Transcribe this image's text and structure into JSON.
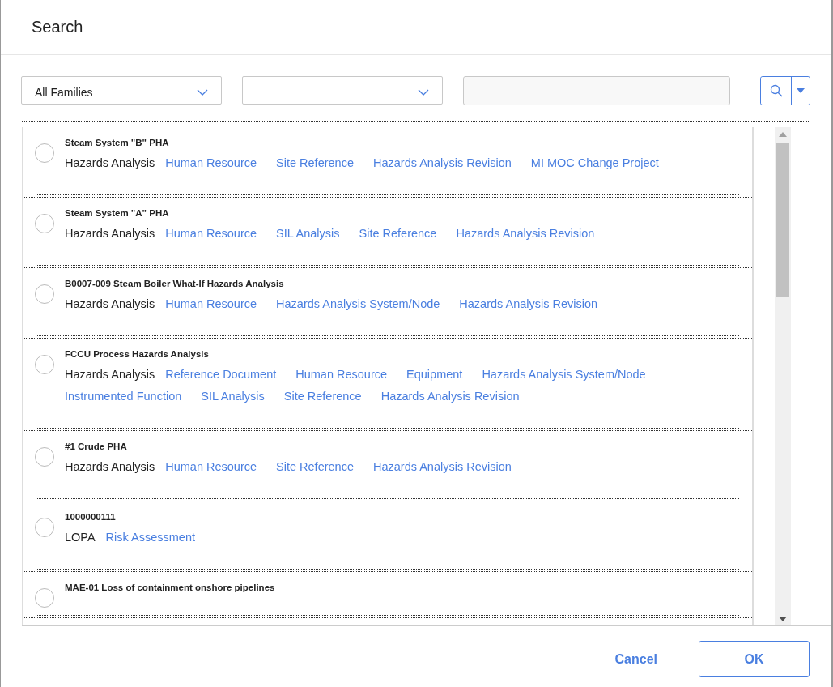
{
  "window": {
    "title": "Search"
  },
  "filters": {
    "family": {
      "value": "All Families"
    }
  },
  "results": [
    {
      "title": "Steam System \"B\" PHA",
      "selected": false,
      "family": "Hazards Analysis",
      "links": [
        "Human Resource",
        "Site Reference",
        "Hazards Analysis Revision",
        "MI MOC Change Project"
      ]
    },
    {
      "title": "Steam System \"A\" PHA",
      "selected": false,
      "family": "Hazards Analysis",
      "links": [
        "Human Resource",
        "SIL Analysis",
        "Site Reference",
        "Hazards Analysis Revision"
      ]
    },
    {
      "title": "B0007-009 Steam Boiler What-If Hazards Analysis",
      "selected": false,
      "family": "Hazards Analysis",
      "links": [
        "Human Resource",
        "Hazards Analysis System/Node",
        "Hazards Analysis Revision"
      ]
    },
    {
      "title": "FCCU Process Hazards Analysis",
      "selected": false,
      "family": "Hazards Analysis",
      "links": [
        "Reference Document",
        "Human Resource",
        "Equipment",
        "Hazards Analysis System/Node",
        "Instrumented Function",
        "SIL Analysis",
        "Site Reference",
        "Hazards Analysis Revision"
      ]
    },
    {
      "title": "#1 Crude PHA",
      "selected": false,
      "family": "Hazards Analysis",
      "links": [
        "Human Resource",
        "Site Reference",
        "Hazards Analysis Revision"
      ]
    },
    {
      "title": "1000000111",
      "selected": false,
      "family": "LOPA",
      "links": [
        "Risk Assessment"
      ]
    },
    {
      "title": "MAE-01 Loss of containment onshore pipelines",
      "selected": false
    }
  ],
  "buttons": {
    "cancel": "Cancel",
    "ok": "OK"
  }
}
